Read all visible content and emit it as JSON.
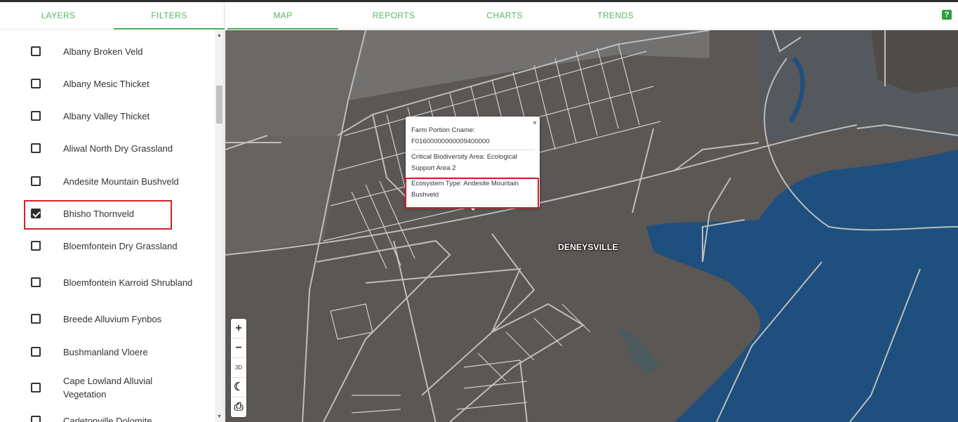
{
  "left_tabs": [
    {
      "label": "LAYERS",
      "active": false
    },
    {
      "label": "FILTERS",
      "active": true
    }
  ],
  "filter_items": [
    {
      "label": "Albany Broken Veld",
      "checked": false
    },
    {
      "label": "Albany Mesic Thicket",
      "checked": false
    },
    {
      "label": "Albany Valley Thicket",
      "checked": false
    },
    {
      "label": "Aliwal North Dry Grassland",
      "checked": false
    },
    {
      "label": "Andesite Mountain Bushveld",
      "checked": false
    },
    {
      "label": "Bhisho Thornveld",
      "checked": true
    },
    {
      "label": "Bloemfontein Dry Grassland",
      "checked": false
    },
    {
      "label": "Bloemfontein Karroid Shrubland",
      "checked": false
    },
    {
      "label": "Breede Alluvium Fynbos",
      "checked": false
    },
    {
      "label": "Bushmanland Vloere",
      "checked": false
    },
    {
      "label": "Cape Lowland Alluvial Vegetation",
      "checked": false
    },
    {
      "label": "Carletonville Dolomite",
      "checked": false
    }
  ],
  "main_tabs": [
    {
      "label": "MAP",
      "active": true
    },
    {
      "label": "REPORTS",
      "active": false
    },
    {
      "label": "CHARTS",
      "active": false
    },
    {
      "label": "TRENDS",
      "active": false
    }
  ],
  "help_label": "?",
  "map": {
    "town_label": "DENEYSVILLE",
    "zoom_in": "+",
    "zoom_out": "−",
    "btn_3d": "3D",
    "night_icon": "moon-icon",
    "print_icon": "printer-icon"
  },
  "popup": {
    "close": "×",
    "farm_portion": "Farm Portion Cname: F01600000000009400000",
    "cba": "Critical Biodiversity Area: Ecological Support Area 2",
    "ecosystem": "Ecosystem Type: Andesite Mountain Bushveld"
  },
  "colors": {
    "accent": "#4cae5b",
    "highlight": "#d0222a",
    "water": "#1e4f7e"
  }
}
